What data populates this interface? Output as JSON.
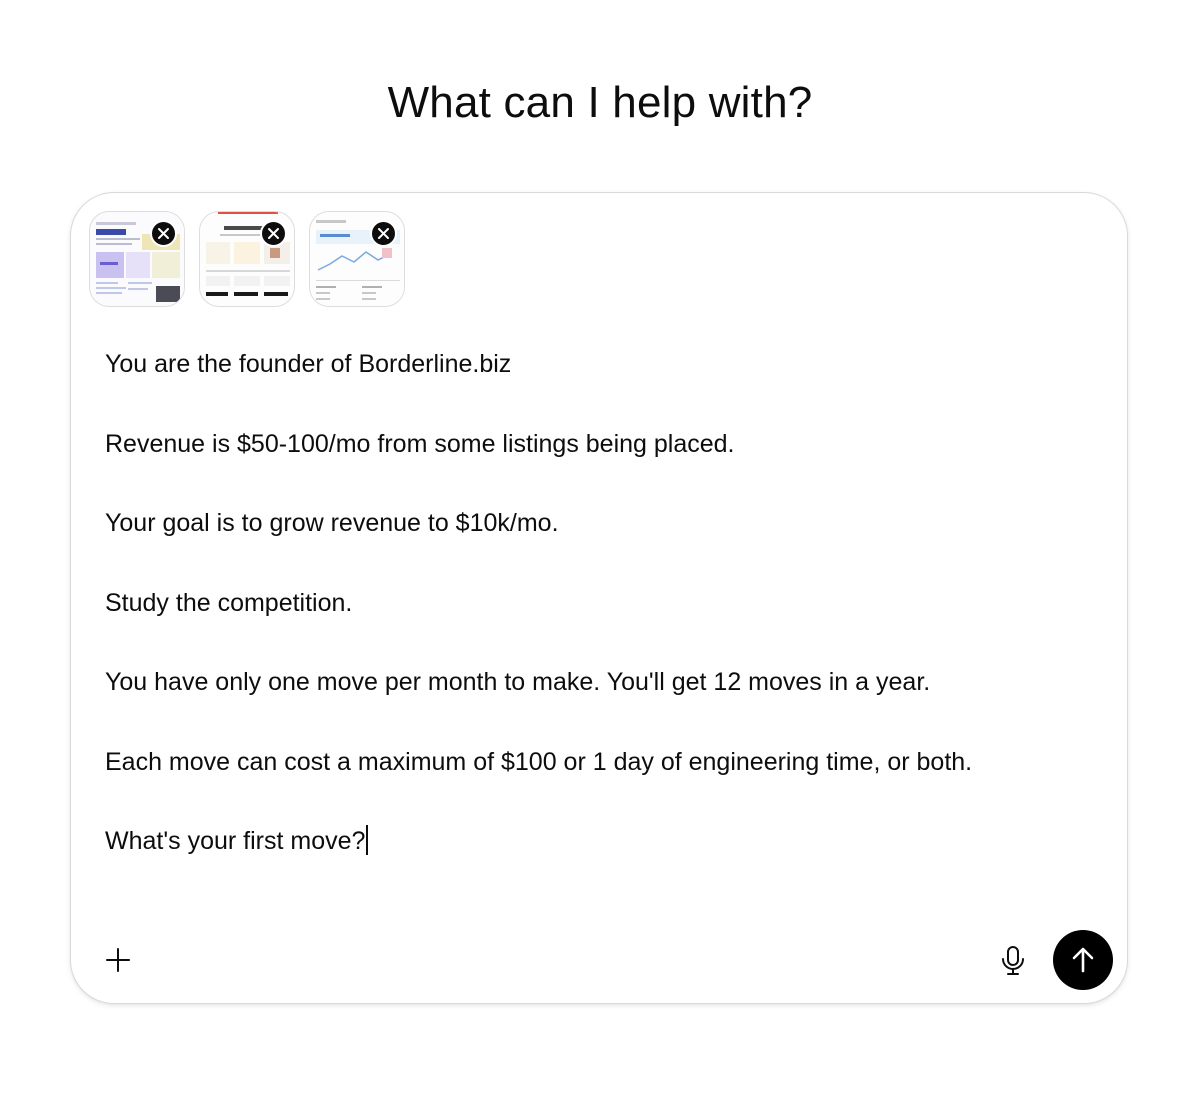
{
  "heading": "What can I help with?",
  "attachments": [
    {
      "name": "screenshot-1",
      "remove_icon": "close-icon"
    },
    {
      "name": "screenshot-2",
      "remove_icon": "close-icon"
    },
    {
      "name": "screenshot-3",
      "remove_icon": "close-icon"
    }
  ],
  "prompt": {
    "lines": [
      "You are the founder of Borderline.biz",
      "Revenue is $50-100/mo from some listings being placed.",
      "Your goal is to grow revenue to $10k/mo.",
      "Study the competition.",
      "You have only one move per month to make. You'll get 12 moves in a year.",
      "Each move can cost a maximum of $100 or 1 day of engineering time, or both.",
      "What's your first move?"
    ]
  },
  "toolbar": {
    "add_icon": "plus-icon",
    "mic_icon": "microphone-icon",
    "send_icon": "arrow-up-icon"
  },
  "colors": {
    "send_button": "#000000",
    "border": "#d9d9d9",
    "text": "#0d0d0d"
  }
}
